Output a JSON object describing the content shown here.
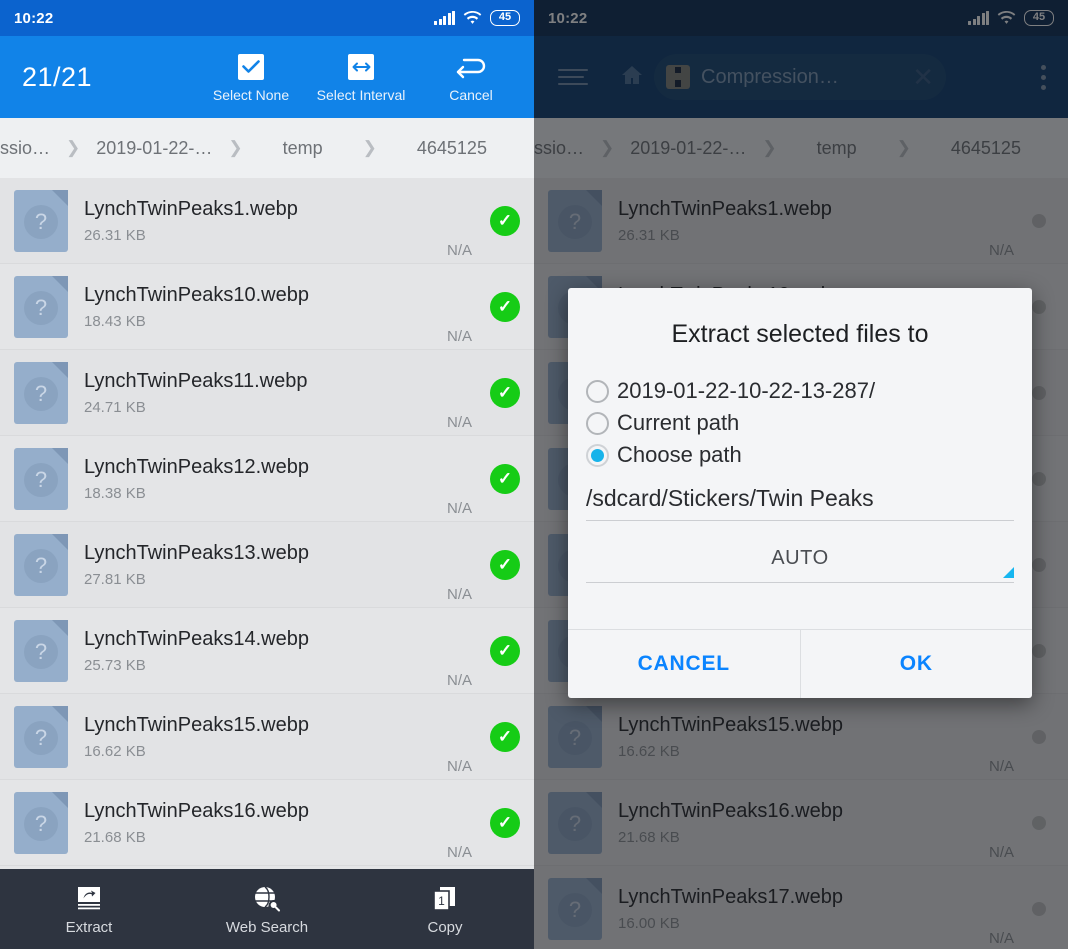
{
  "status_bar": {
    "time": "10:22",
    "battery": "45",
    "signal_icon": "signal-bars-icon",
    "wifi_icon": "wifi-icon"
  },
  "left_panel": {
    "selection_count": "21/21",
    "actions": [
      {
        "label": "Select None",
        "icon": "checkbox-checked-icon"
      },
      {
        "label": "Select Interval",
        "icon": "arrows-horizontal-icon"
      },
      {
        "label": "Cancel",
        "icon": "undo-arrow-icon"
      }
    ],
    "breadcrumb": [
      "ssio…",
      "2019-01-22-…",
      "temp",
      "4645125"
    ],
    "files": [
      {
        "name": "LynchTwinPeaks1.webp",
        "size": "26.31 KB",
        "date": "N/A",
        "selected": true
      },
      {
        "name": "LynchTwinPeaks10.webp",
        "size": "18.43 KB",
        "date": "N/A",
        "selected": true
      },
      {
        "name": "LynchTwinPeaks11.webp",
        "size": "24.71 KB",
        "date": "N/A",
        "selected": true
      },
      {
        "name": "LynchTwinPeaks12.webp",
        "size": "18.38 KB",
        "date": "N/A",
        "selected": true
      },
      {
        "name": "LynchTwinPeaks13.webp",
        "size": "27.81 KB",
        "date": "N/A",
        "selected": true
      },
      {
        "name": "LynchTwinPeaks14.webp",
        "size": "25.73 KB",
        "date": "N/A",
        "selected": true
      },
      {
        "name": "LynchTwinPeaks15.webp",
        "size": "16.62 KB",
        "date": "N/A",
        "selected": true
      },
      {
        "name": "LynchTwinPeaks16.webp",
        "size": "21.68 KB",
        "date": "N/A",
        "selected": true
      }
    ],
    "bottom_bar": [
      {
        "label": "Extract",
        "icon": "extract-archive-icon"
      },
      {
        "label": "Web Search",
        "icon": "globe-search-icon"
      },
      {
        "label": "Copy",
        "icon": "copy-pages-icon"
      }
    ]
  },
  "right_panel": {
    "menu_icon": "hamburger-menu-icon",
    "home_icon": "home-icon",
    "search_value": "Compression…",
    "search_file_icon": "archive-zip-icon",
    "clear_icon": "close-x-icon",
    "overflow_icon": "kebab-menu-icon",
    "breadcrumb": [
      "ssio…",
      "2019-01-22-…",
      "temp",
      "4645125"
    ],
    "files": [
      {
        "name": "LynchTwinPeaks1.webp",
        "size": "26.31 KB",
        "date": "N/A"
      },
      {
        "name": "LynchTwinPeaks10.webp",
        "size": "18.43 KB",
        "date": "N/A"
      },
      {
        "name": "LynchTwinPeaks11.webp",
        "size": "24.71 KB",
        "date": "N/A"
      },
      {
        "name": "LynchTwinPeaks12.webp",
        "size": "18.38 KB",
        "date": "N/A"
      },
      {
        "name": "LynchTwinPeaks13.webp",
        "size": "27.81 KB",
        "date": "N/A"
      },
      {
        "name": "LynchTwinPeaks14.webp",
        "size": "25.73 KB",
        "date": "N/A"
      },
      {
        "name": "LynchTwinPeaks15.webp",
        "size": "16.62 KB",
        "date": "N/A"
      },
      {
        "name": "LynchTwinPeaks16.webp",
        "size": "21.68 KB",
        "date": "N/A"
      },
      {
        "name": "LynchTwinPeaks17.webp",
        "size": "16.00 KB",
        "date": "N/A"
      }
    ]
  },
  "dialog": {
    "title": "Extract selected files to",
    "options": [
      {
        "label": "2019-01-22-10-22-13-287/",
        "selected": false
      },
      {
        "label": "Current path",
        "selected": false
      },
      {
        "label": "Choose path",
        "selected": true
      }
    ],
    "path_value": "/sdcard/Stickers/Twin Peaks",
    "encoding_value": "AUTO",
    "cancel_label": "CANCEL",
    "ok_label": "OK"
  },
  "colors": {
    "accent_blue": "#1183e8",
    "status_blue": "#0b63ce",
    "dark_blue": "#0a2a52",
    "check_green": "#16cc16",
    "radio_cyan": "#17b3ea",
    "dialog_link": "#0a84ff",
    "toolbar_dark": "#2e3440"
  }
}
